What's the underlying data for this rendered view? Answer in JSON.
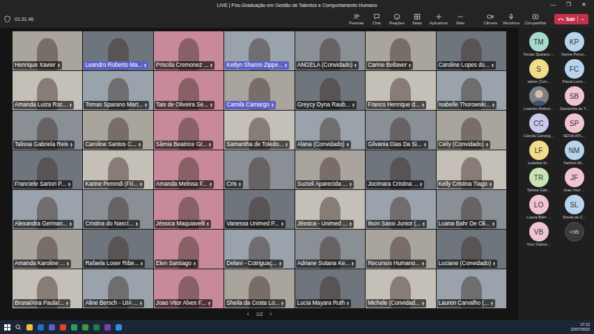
{
  "window": {
    "title": "LIVE | Pós-Graduação em Gestão de Talentos e Comportamento Humano",
    "controls": [
      "—",
      "❐",
      "✕"
    ]
  },
  "timer": "01:31:46",
  "toolbar": [
    {
      "label": "Pessoas",
      "kind": "people"
    },
    {
      "label": "Chat",
      "kind": "chat"
    },
    {
      "label": "Reações",
      "kind": "reactions"
    },
    {
      "label": "Salas",
      "kind": "rooms"
    },
    {
      "label": "Aplicativos",
      "kind": "apps"
    },
    {
      "label": "Mais",
      "kind": "more"
    },
    {
      "label": "Câmera",
      "kind": "camera"
    },
    {
      "label": "Microfone",
      "kind": "mic"
    },
    {
      "label": "Compartilhar",
      "kind": "share"
    }
  ],
  "leave_button": {
    "label": "Sair",
    "chevron": "⌄"
  },
  "tiles": [
    {
      "name": "Henrique Xavier",
      "highlighted": false
    },
    {
      "name": "Leandro Roberto Ma...",
      "highlighted": true
    },
    {
      "name": "Priscila Cremonez ...",
      "highlighted": false
    },
    {
      "name": "Ketlyn Sharon Zippe...",
      "highlighted": true
    },
    {
      "name": "ANGELA (Convidado)",
      "highlighted": false
    },
    {
      "name": "Carine Bellaver",
      "highlighted": false
    },
    {
      "name": "Caroline Lopes do...",
      "highlighted": false
    },
    {
      "name": "Amanda Luiza Roc...",
      "highlighted": false
    },
    {
      "name": "Tomas Sparano Mart...",
      "highlighted": false
    },
    {
      "name": "Tais de Oliveira Se...",
      "highlighted": false
    },
    {
      "name": "Camila Camargo",
      "highlighted": true
    },
    {
      "name": "Greycy Dyna Raub...",
      "highlighted": false
    },
    {
      "name": "Franco Henrique d...",
      "highlighted": false
    },
    {
      "name": "Isabelle Thorowski...",
      "highlighted": false
    },
    {
      "name": "Talissa Gabriela Reis",
      "highlighted": false
    },
    {
      "name": "Caroline Santos C...",
      "highlighted": false
    },
    {
      "name": "Sâmia Beatrice Gr...",
      "highlighted": false
    },
    {
      "name": "Samantha de Toledo...",
      "highlighted": false
    },
    {
      "name": "Alana (Convidado)",
      "highlighted": false
    },
    {
      "name": "Gilvania Dias Da Si...",
      "highlighted": false
    },
    {
      "name": "Ciély (Convidado)",
      "highlighted": false
    },
    {
      "name": "Franciele Sartori P...",
      "highlighted": false
    },
    {
      "name": "Karine Perondi (Fri...",
      "highlighted": false
    },
    {
      "name": "Amanda Melissa F...",
      "highlighted": false
    },
    {
      "name": "Cris",
      "highlighted": false
    },
    {
      "name": "Suzieli Aparecida ...",
      "highlighted": false
    },
    {
      "name": "Jocimara Cristina ...",
      "highlighted": false
    },
    {
      "name": "Kelly Cristina Tiago",
      "highlighted": false
    },
    {
      "name": "Alexandra German...",
      "highlighted": false
    },
    {
      "name": "Cristina do Nascí...",
      "highlighted": false
    },
    {
      "name": "Jéssica Maquiavelli",
      "highlighted": false
    },
    {
      "name": "Vanessa Unimed P...",
      "highlighted": false
    },
    {
      "name": "Jéssica - Unimed ...",
      "highlighted": false
    },
    {
      "name": "Ilson Sassi Junior (...",
      "highlighted": false
    },
    {
      "name": "Luana Bahr De Oli...",
      "highlighted": false
    },
    {
      "name": "Amanda Karoline ...",
      "highlighted": false
    },
    {
      "name": "Rafaela Loser Ribe...",
      "highlighted": false
    },
    {
      "name": "Elen Santiago",
      "highlighted": false
    },
    {
      "name": "Delani - Cotriguaç...",
      "highlighted": false
    },
    {
      "name": "Adriane Sotana Ke...",
      "highlighted": false
    },
    {
      "name": "Recursos Humano...",
      "highlighted": false
    },
    {
      "name": "Luciane (Convidado)",
      "highlighted": false
    },
    {
      "name": "Bruna/Ana Paula/...",
      "highlighted": false
    },
    {
      "name": "Aline Bersch - UIA ...",
      "highlighted": false
    },
    {
      "name": "Joao Vitor Alves F...",
      "highlighted": false
    },
    {
      "name": "Sheila da Costa Lo...",
      "highlighted": false
    },
    {
      "name": "Lucia Mayara Ruth",
      "highlighted": false
    },
    {
      "name": "Michele (Convidad...",
      "highlighted": false
    },
    {
      "name": "Lauren Carvalho (...",
      "highlighted": false
    }
  ],
  "pagination": {
    "prev": "‹",
    "page": "1/2",
    "next": "›"
  },
  "roster": [
    {
      "kind": "initials",
      "initials": "TM",
      "name": "Tomas Sparano ...",
      "color": "#a8d8d0"
    },
    {
      "kind": "initials",
      "initials": "KP",
      "name": "Karine Peron...",
      "color": "#b8d4ec"
    },
    {
      "kind": "initials",
      "initials": "S",
      "name": "salete (Con...",
      "color": "#f0dc8c"
    },
    {
      "kind": "initials",
      "initials": "FC",
      "name": "Flavia Lucin...",
      "color": "#b8d4ec"
    },
    {
      "kind": "photo",
      "initials": "",
      "name": "Leandro Robert...",
      "color": "#7a8088"
    },
    {
      "kind": "initials",
      "initials": "SB",
      "name": "Samantha de T...",
      "color": "#f0c4d0"
    },
    {
      "kind": "initials",
      "initials": "CC",
      "name": "Camila Camarg...",
      "color": "#c8c8ec"
    },
    {
      "kind": "initials",
      "initials": "SP",
      "name": "SEIVA APL...",
      "color": "#f0c4d0"
    },
    {
      "kind": "initials",
      "initials": "LF",
      "name": "Lodelisa M...",
      "color": "#f0dc8c"
    },
    {
      "kind": "initials",
      "initials": "NM",
      "name": "Nathieli Mi...",
      "color": "#b8d4ec"
    },
    {
      "kind": "initials",
      "initials": "TR",
      "name": "Talissa Gab...",
      "color": "#c8e4b4"
    },
    {
      "kind": "initials",
      "initials": "JF",
      "name": "Joao Vitor ...",
      "color": "#f0c4d0"
    },
    {
      "kind": "initials",
      "initials": "LO",
      "name": "Luana Bahr ...",
      "color": "#f0c4d0"
    },
    {
      "kind": "initials",
      "initials": "SL",
      "name": "Sheila da C...",
      "color": "#b8d4ec"
    },
    {
      "kind": "initials",
      "initials": "VB",
      "name": "Vitor Gabrie...",
      "color": "#f0c4d0"
    },
    {
      "kind": "more",
      "initials": "+95",
      "name": "",
      "color": "#3a3a3a"
    }
  ],
  "taskbar": {
    "time": "17:12",
    "date": "22/07/2022"
  }
}
